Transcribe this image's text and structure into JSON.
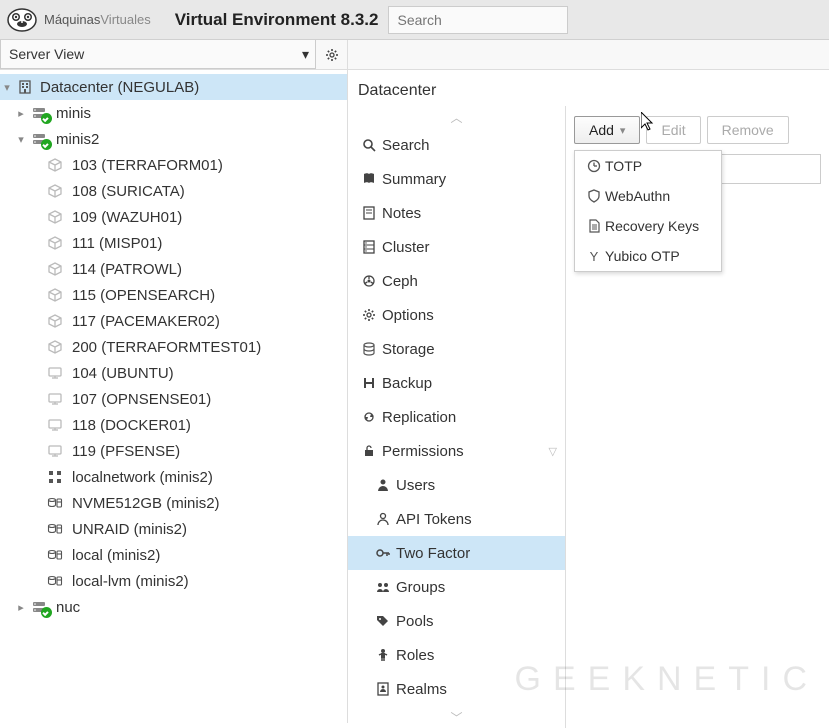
{
  "header": {
    "brand1": "Máquinas",
    "brand2": "Virtuales",
    "env_title": "Virtual Environment 8.3.2",
    "search_placeholder": "Search"
  },
  "toolbar": {
    "server_view_label": "Server View"
  },
  "tree": {
    "root_label": "Datacenter (NEGULAB)",
    "nodes": [
      {
        "type": "node",
        "label": "minis",
        "expanded": false,
        "depth": 1
      },
      {
        "type": "node",
        "label": "minis2",
        "expanded": true,
        "depth": 1
      },
      {
        "type": "ct",
        "label": "103 (TERRAFORM01)",
        "depth": 2
      },
      {
        "type": "ct",
        "label": "108 (SURICATA)",
        "depth": 2
      },
      {
        "type": "ct",
        "label": "109 (WAZUH01)",
        "depth": 2
      },
      {
        "type": "ct",
        "label": "111 (MISP01)",
        "depth": 2
      },
      {
        "type": "ct",
        "label": "114 (PATROWL)",
        "depth": 2
      },
      {
        "type": "ct",
        "label": "115 (OPENSEARCH)",
        "depth": 2
      },
      {
        "type": "ct",
        "label": "117 (PACEMAKER02)",
        "depth": 2
      },
      {
        "type": "ct",
        "label": "200 (TERRAFORMTEST01)",
        "depth": 2
      },
      {
        "type": "vm",
        "label": "104 (UBUNTU)",
        "depth": 2
      },
      {
        "type": "vm",
        "label": "107 (OPNSENSE01)",
        "depth": 2
      },
      {
        "type": "vm",
        "label": "118 (DOCKER01)",
        "depth": 2
      },
      {
        "type": "vm",
        "label": "119 (PFSENSE)",
        "depth": 2
      },
      {
        "type": "sdn",
        "label": "localnetwork (minis2)",
        "depth": 2
      },
      {
        "type": "storage",
        "label": "NVME512GB (minis2)",
        "depth": 2
      },
      {
        "type": "storage",
        "label": "UNRAID (minis2)",
        "depth": 2
      },
      {
        "type": "storage",
        "label": "local (minis2)",
        "depth": 2
      },
      {
        "type": "storage",
        "label": "local-lvm (minis2)",
        "depth": 2
      },
      {
        "type": "node",
        "label": "nuc",
        "expanded": false,
        "depth": 1
      }
    ]
  },
  "breadcrumb": "Datacenter",
  "nav": [
    {
      "id": "search",
      "label": "Search",
      "icon": "search"
    },
    {
      "id": "summary",
      "label": "Summary",
      "icon": "book"
    },
    {
      "id": "notes",
      "label": "Notes",
      "icon": "note"
    },
    {
      "id": "cluster",
      "label": "Cluster",
      "icon": "server"
    },
    {
      "id": "ceph",
      "label": "Ceph",
      "icon": "ceph"
    },
    {
      "id": "options",
      "label": "Options",
      "icon": "gear"
    },
    {
      "id": "storage",
      "label": "Storage",
      "icon": "db"
    },
    {
      "id": "backup",
      "label": "Backup",
      "icon": "save"
    },
    {
      "id": "replication",
      "label": "Replication",
      "icon": "repl"
    },
    {
      "id": "permissions",
      "label": "Permissions",
      "icon": "unlock",
      "expandable": true
    },
    {
      "id": "users",
      "label": "Users",
      "icon": "user",
      "sub": true
    },
    {
      "id": "apitokens",
      "label": "API Tokens",
      "icon": "useroutline",
      "sub": true
    },
    {
      "id": "twofactor",
      "label": "Two Factor",
      "icon": "key",
      "sub": true,
      "selected": true
    },
    {
      "id": "groups",
      "label": "Groups",
      "icon": "group",
      "sub": true
    },
    {
      "id": "pools",
      "label": "Pools",
      "icon": "tags",
      "sub": true
    },
    {
      "id": "roles",
      "label": "Roles",
      "icon": "male",
      "sub": true
    },
    {
      "id": "realms",
      "label": "Realms",
      "icon": "addressbook",
      "sub": true
    }
  ],
  "buttons": {
    "add": "Add",
    "edit": "Edit",
    "remove": "Remove"
  },
  "dropdown": [
    {
      "id": "totp",
      "icon": "clock",
      "label": "TOTP"
    },
    {
      "id": "webauthn",
      "icon": "shield",
      "label": "WebAuthn"
    },
    {
      "id": "recovery",
      "icon": "filetext",
      "label": "Recovery Keys"
    },
    {
      "id": "yubico",
      "icon": "y",
      "label": "Yubico OTP"
    }
  ],
  "watermark": "GEEKNETIC"
}
